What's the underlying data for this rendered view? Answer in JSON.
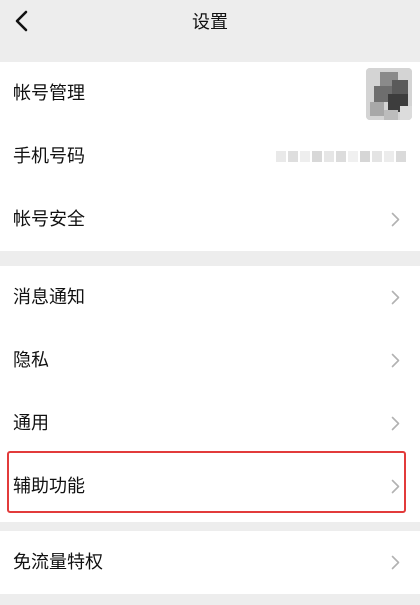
{
  "header": {
    "title": "设置",
    "back_icon": "chevron-left-icon"
  },
  "groups": [
    {
      "items": [
        {
          "label": "帐号管理",
          "accessory": "avatar"
        },
        {
          "label": "手机号码",
          "accessory": "phone-number-blurred"
        },
        {
          "label": "帐号安全",
          "accessory": "chevron-right-icon"
        }
      ]
    },
    {
      "items": [
        {
          "label": "消息通知",
          "accessory": "chevron-right-icon"
        },
        {
          "label": "隐私",
          "accessory": "chevron-right-icon"
        },
        {
          "label": "通用",
          "accessory": "chevron-right-icon"
        },
        {
          "label": "辅助功能",
          "accessory": "chevron-right-icon",
          "highlighted": true
        }
      ]
    },
    {
      "items": [
        {
          "label": "免流量特权",
          "accessory": "chevron-right-icon"
        }
      ]
    }
  ],
  "colors": {
    "background": "#ededed",
    "surface": "#ffffff",
    "text": "#111111",
    "chevron": "#b2b2b2",
    "highlight_border": "#e23b3b"
  }
}
